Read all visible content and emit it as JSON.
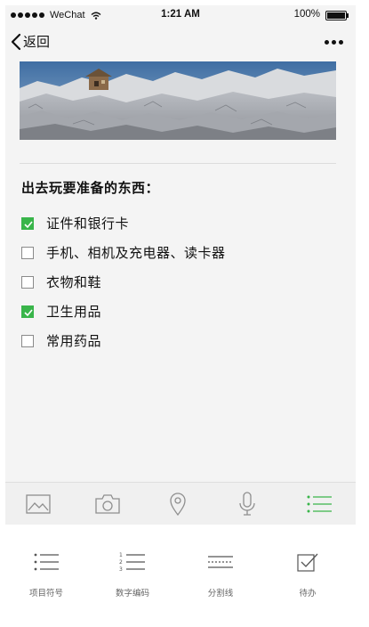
{
  "status_bar": {
    "carrier": "WeChat",
    "time": "1:21 AM",
    "battery": "100%"
  },
  "nav": {
    "back_label": "返回"
  },
  "note": {
    "heading": "出去玩要准备的东西：",
    "items": [
      {
        "label": "证件和银行卡",
        "checked": true
      },
      {
        "label": "手机、相机及充电器、读卡器",
        "checked": false
      },
      {
        "label": "衣物和鞋",
        "checked": false
      },
      {
        "label": "卫生用品",
        "checked": true
      },
      {
        "label": "常用药品",
        "checked": false
      }
    ]
  },
  "toolbar": {
    "tools": [
      "image-icon",
      "camera-icon",
      "location-icon",
      "microphone-icon",
      "checklist-icon"
    ],
    "active_tool": "checklist-icon",
    "active_color": "#39b54a"
  },
  "format_panel": {
    "options": [
      {
        "icon": "bullet-list-icon",
        "label": "项目符号"
      },
      {
        "icon": "numbered-list-icon",
        "label": "数字编码"
      },
      {
        "icon": "divider-line-icon",
        "label": "分割线"
      },
      {
        "icon": "todo-icon",
        "label": "待办"
      }
    ]
  }
}
